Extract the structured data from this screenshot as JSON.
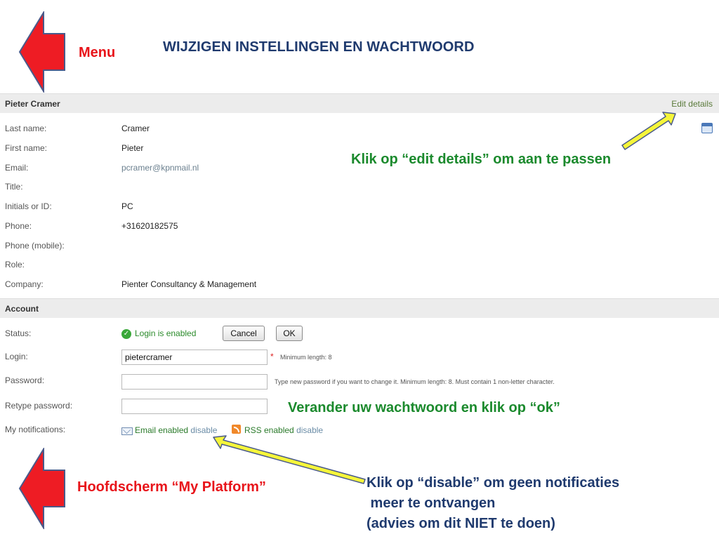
{
  "slide": {
    "title": "WIJZIGEN INSTELLINGEN EN WACHTWOORD",
    "menu_label": "Menu",
    "home_label": "Hoofdscherm “My Platform”",
    "note_edit": "Klik op “edit details” om aan te passen",
    "note_password": "Verander uw wachtwoord en klik op “ok”",
    "note_disable": [
      "Klik op “disable” om geen notificaties",
      " meer te ontvangen",
      "(advies om dit NIET te doen)"
    ]
  },
  "colors": {
    "arrow_red": "#ee1c24",
    "arrow_outline": "#4a5a8a",
    "pointer_yellow": "#f5f53a",
    "note_green": "#1b8a2d",
    "title_blue": "#1f3a6e"
  },
  "profile": {
    "name": "Pieter Cramer",
    "edit_label": "Edit details",
    "icon": "calendar-icon",
    "fields": [
      {
        "label": "Last name:",
        "value": "Cramer"
      },
      {
        "label": "First name:",
        "value": "Pieter"
      },
      {
        "label": "Email:",
        "value": "pcramer@kpnmail.nl"
      },
      {
        "label": "Title:",
        "value": ""
      },
      {
        "label": "Initials or ID:",
        "value": "PC"
      },
      {
        "label": "Phone:",
        "value": "+31620182575"
      },
      {
        "label": "Phone (mobile):",
        "value": ""
      },
      {
        "label": "Role:",
        "value": ""
      },
      {
        "label": "Company:",
        "value": "Pienter Consultancy & Management"
      }
    ]
  },
  "account": {
    "heading": "Account",
    "status_label": "Status:",
    "status_text": "Login is enabled",
    "cancel_label": "Cancel",
    "ok_label": "OK",
    "login_label": "Login:",
    "login_value": "pietercramer",
    "login_hint": "Minimum length: 8",
    "password_label": "Password:",
    "password_hint": "Type new password if you want to change it. Minimum length: 8. Must contain 1 non-letter character.",
    "retype_label": "Retype password:",
    "notifications_label": "My notifications:",
    "email_enabled": "Email enabled",
    "email_disable": "disable",
    "rss_enabled": "RSS enabled",
    "rss_disable": "disable"
  }
}
